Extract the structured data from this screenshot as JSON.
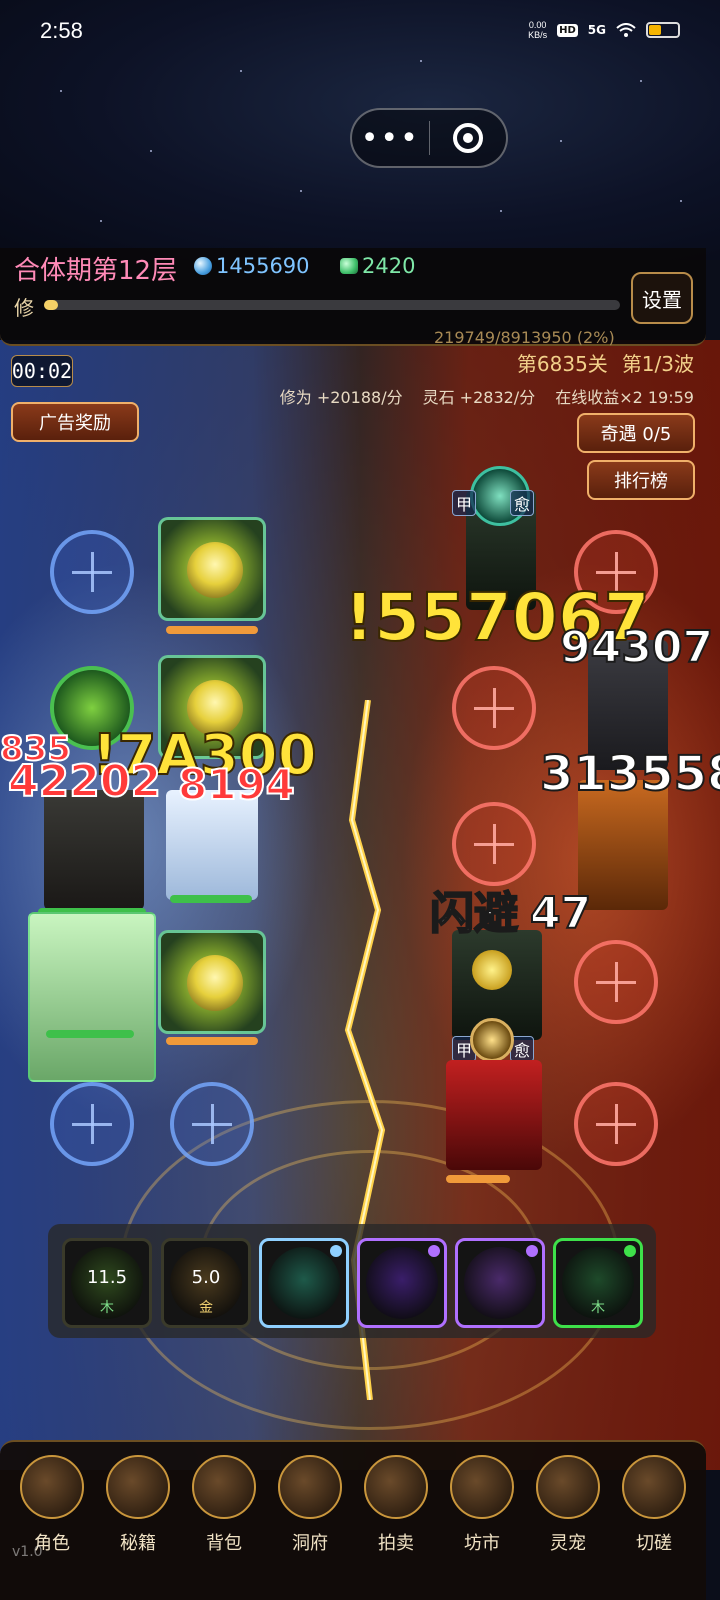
{
  "status_bar": {
    "time": "2:58",
    "net_speed_value": "0.00",
    "net_speed_unit": "KB/s",
    "hd": "HD",
    "signal": "5G",
    "battery_level": 0.4
  },
  "capsule": {
    "more": "•••"
  },
  "header": {
    "realm": "合体期第12层",
    "spirit_stones": "1455690",
    "jade": "2420",
    "cultivation_label": "修",
    "cultivation_progress_text": "219749/8913950 (2%)",
    "cultivation_fraction": 0.02,
    "settings_label": "设置"
  },
  "stage": {
    "timer": "00:02",
    "level": "第6835关",
    "wave": "第1/3波",
    "cultivation_rate": "修为 +20188/分",
    "stone_rate": "灵石 +2832/分",
    "online_bonus": "在线收益×2 19:59"
  },
  "buttons": {
    "ad_reward": "广告奖励",
    "encounter": "奇遇 0/5",
    "ranking": "排行榜"
  },
  "battle_tags": {
    "enemy_top_left": "甲",
    "enemy_top_right": "愈",
    "enemy_bottom_left": "甲",
    "enemy_bottom_right": "愈"
  },
  "damage_numbers": {
    "big_crit": "!557067",
    "enemy_hit_1": "94307",
    "enemy_hit_2": "313558",
    "dodge": "闪避",
    "enemy_hit_3": "47",
    "ally_big": "!7A300",
    "ally_hit_1": "835",
    "ally_hit_2": "42202",
    "ally_hit_3": "8194"
  },
  "skills": [
    {
      "cooldown": "11.5",
      "element": "木",
      "color": "#2f4a1e",
      "border": "#3a3a2a"
    },
    {
      "cooldown": "5.0",
      "element": "金",
      "color": "#4a3a1e",
      "border": "#3a3a2a"
    },
    {
      "cooldown": "",
      "element": "",
      "color": "#1e5a4a",
      "border": "#8fd0ff",
      "dot": "#8fd0ff"
    },
    {
      "cooldown": "",
      "element": "",
      "color": "#3a1e6a",
      "border": "#b070ff",
      "dot": "#b070ff"
    },
    {
      "cooldown": "",
      "element": "",
      "color": "#4a2a6a",
      "border": "#b070ff",
      "dot": "#b070ff"
    },
    {
      "cooldown": "",
      "element": "木",
      "color": "#1e4a2a",
      "border": "#3ee04a",
      "dot": "#3ee04a"
    }
  ],
  "nav": [
    {
      "label": "角色",
      "icon": "character-icon"
    },
    {
      "label": "秘籍",
      "icon": "manual-icon"
    },
    {
      "label": "背包",
      "icon": "bag-icon"
    },
    {
      "label": "洞府",
      "icon": "cave-icon"
    },
    {
      "label": "拍卖",
      "icon": "auction-icon"
    },
    {
      "label": "坊市",
      "icon": "market-icon"
    },
    {
      "label": "灵宠",
      "icon": "spirit-pet-icon"
    },
    {
      "label": "切磋",
      "icon": "spar-icon"
    }
  ],
  "version": "v1.0"
}
